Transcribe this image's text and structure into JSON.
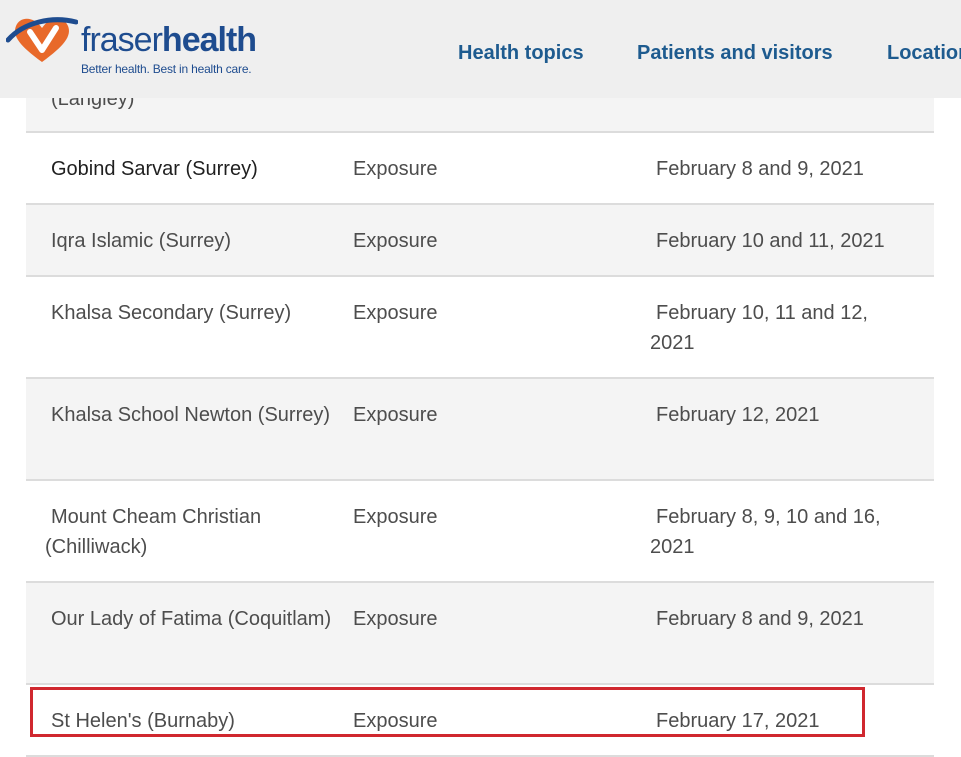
{
  "brand": {
    "name_light": "fraser",
    "name_bold": "health",
    "tagline": "Better health. Best in health care."
  },
  "nav": {
    "items": [
      {
        "label": "Health topics"
      },
      {
        "label": "Patients and visitors"
      },
      {
        "label": "Locations"
      }
    ]
  },
  "colors": {
    "header_bg": "#efefef",
    "brand_blue": "#1e4c8f",
    "nav_blue": "#1e5b8f",
    "logo_orange": "#e8692a",
    "row_shade": "#f4f4f4",
    "highlight_red": "#d0282f"
  },
  "table": {
    "partial_row_label": "(Langley)",
    "rows": [
      {
        "school": "Gobind Sarvar (Surrey)",
        "type": "Exposure",
        "dates": "February 8 and 9, 2021"
      },
      {
        "school": "Iqra Islamic (Surrey)",
        "type": "Exposure",
        "dates": "February 10 and 11, 2021"
      },
      {
        "school": "Khalsa Secondary (Surrey)",
        "type": "Exposure",
        "dates": "February 10, 11 and 12, 2021"
      },
      {
        "school": "Khalsa School Newton (Surrey)",
        "type": "Exposure",
        "dates": "February 12, 2021"
      },
      {
        "school": "Mount Cheam Christian (Chilliwack)",
        "type": "Exposure",
        "dates": "February 8, 9, 10 and 16, 2021"
      },
      {
        "school": "Our Lady of Fatima (Coquitlam)",
        "type": "Exposure",
        "dates": "February 8 and 9, 2021"
      },
      {
        "school": "St Helen's (Burnaby)",
        "type": "Exposure",
        "dates": "February 17, 2021"
      }
    ]
  }
}
